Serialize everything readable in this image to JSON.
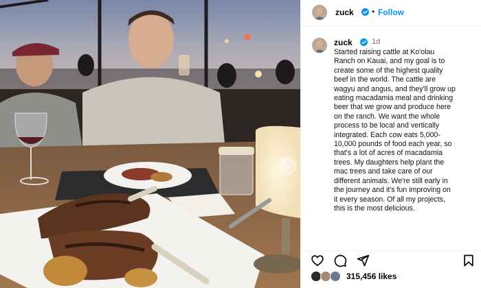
{
  "post": {
    "username": "zuck",
    "follow_label": "Follow",
    "separator": "•",
    "time_ago": "1d",
    "caption": "Started raising cattle at Ko'olau\nRanch on Kauai, and my goal is to\ncreate some of the highest quality\nbeef in the world. The cattle are\nwagyu and angus, and they'll grow up\neating macadamia meal and drinking\nbeer that we grow and produce here\non the ranch. We want the whole\nprocess to be local and vertically\nintegrated. Each cow eats 5,000-\n10,000 pounds of food each year, so\nthat's a lot of acres of macadamia\ntrees. My daughters help plant the\nmac trees and take care of our\ndifferent animals. We're still early in\nthe journey and it's fun improving on\nit every season. Of all my projects,\nthis is the most delicious.",
    "likes_count": "315,456 likes"
  },
  "icons": {
    "more": "more-options-icon",
    "verified": "verified-badge-icon",
    "like": "heart-icon",
    "comment": "comment-icon",
    "share": "share-icon",
    "save": "bookmark-icon",
    "next": "chevron-right-icon"
  },
  "colors": {
    "link": "#0095f6",
    "verified": "#0095f6",
    "muted": "#737373"
  }
}
